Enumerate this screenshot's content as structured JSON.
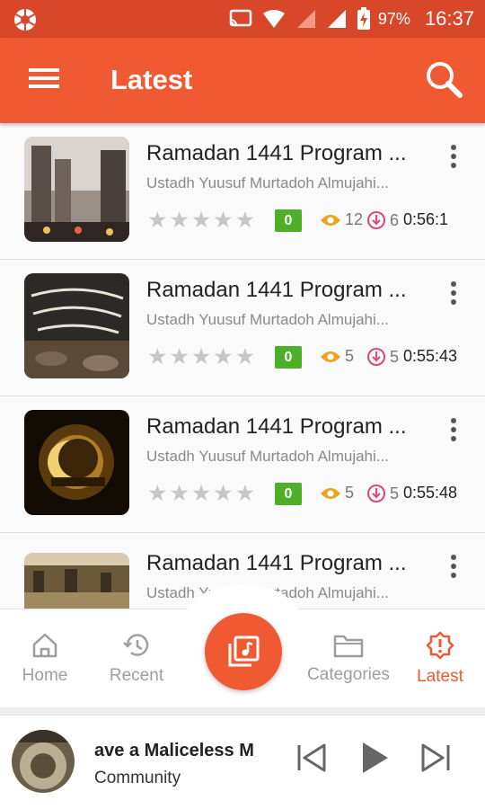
{
  "status_bar": {
    "battery": "97%",
    "time": "16:37"
  },
  "app_bar": {
    "title": "Latest"
  },
  "items": [
    {
      "title": "Ramadan 1441 Program ...",
      "artist": "Ustadh Yuusuf Murtadoh Almujahi...",
      "rating_badge": "0",
      "views": "12",
      "downloads": "6",
      "duration": "0:56:1"
    },
    {
      "title": "Ramadan 1441 Program ...",
      "artist": "Ustadh Yuusuf Murtadoh Almujahi...",
      "rating_badge": "0",
      "views": "5",
      "downloads": "5",
      "duration": "0:55:43"
    },
    {
      "title": "Ramadan 1441 Program ...",
      "artist": "Ustadh Yuusuf Murtadoh Almujahi...",
      "rating_badge": "0",
      "views": "5",
      "downloads": "5",
      "duration": "0:55:48"
    },
    {
      "title": "Ramadan 1441 Program ...",
      "artist": "Ustadh Yuusuf Murtadoh Almujahi..."
    }
  ],
  "bottom_nav": [
    {
      "label": "Home",
      "icon": "home-icon"
    },
    {
      "label": "Recent",
      "icon": "history-icon"
    },
    {
      "label": "",
      "icon": "music-library-icon"
    },
    {
      "label": "Categories",
      "icon": "folder-icon"
    },
    {
      "label": "Latest",
      "icon": "alert-badge-icon",
      "active": true
    }
  ],
  "player": {
    "track": "ave a Maliceless M",
    "artist": "Community"
  },
  "colors": {
    "accent": "#f05a32",
    "status_bar": "#d9472a",
    "badge_green": "#4caf27",
    "eye_orange": "#f0a020",
    "download_pink": "#e0457b"
  }
}
